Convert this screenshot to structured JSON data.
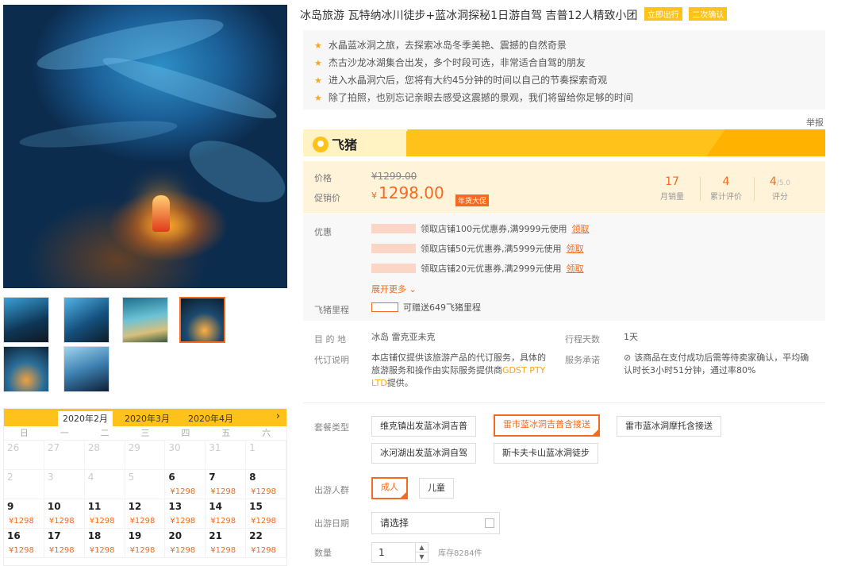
{
  "product": {
    "title": "冰岛旅游 瓦特纳冰川徒步+蓝冰洞探秘1日游自驾 吉普12人精致小团",
    "tags": [
      "立即出行",
      "二次确认"
    ],
    "highlights": [
      "水晶蓝冰洞之旅，去探索冰岛冬季美艳、震撼的自然奇景",
      "杰古沙龙冰湖集合出发，多个时段可选，非常适合自驾的朋友",
      "进入水晶洞穴后，您将有大约45分钟的时间以自己的节奏探索奇观",
      "除了拍照，也别忘记亲眼去感受这震撼的景观，我们将留给你足够的时间"
    ],
    "report_label": "举报"
  },
  "brand": {
    "name": "飞猪",
    "accent": "#ffc21a",
    "orange": "#f56a1f"
  },
  "price": {
    "label": "价格",
    "original": "¥1299.00",
    "promo_label": "促销价",
    "currency": "¥",
    "current": "1298.00",
    "badge": "年货大促",
    "stats": [
      {
        "value": "17",
        "label": "月销量"
      },
      {
        "value": "4",
        "label": "累计评价"
      },
      {
        "value": "4",
        "suffix": "/5.0",
        "label": "评分"
      }
    ]
  },
  "promotions": {
    "label": "优惠",
    "coupons": [
      {
        "text": "领取店铺100元优惠券,满9999元使用",
        "action": "领取"
      },
      {
        "text": "领取店铺50元优惠券,满5999元使用",
        "action": "领取"
      },
      {
        "text": "领取店铺20元优惠券,满2999元使用",
        "action": "领取"
      }
    ],
    "more": "展开更多",
    "miles_label": "飞猪里程",
    "miles_text": "可赠送649飞猪里程"
  },
  "details": {
    "dest_label": "目 的 地",
    "dest_value": "冰岛  雷克亚未克",
    "days_label": "行程天数",
    "days_value": "1天",
    "agency_label": "代订说明",
    "agency_text": "本店铺仅提供该旅游产品的代订服务，具体的旅游服务和操作由实际服务提供商",
    "agency_company": "GDST PTY LTD",
    "agency_end": "提供。",
    "promise_label": "服务承诺",
    "promise_text": "该商品在支付成功后需等待卖家确认，平均确认时长3小时51分钟，通过率80%"
  },
  "package": {
    "label": "套餐类型",
    "options": [
      "维克镇出发蓝冰洞吉普",
      "雷市蓝冰洞吉普含接送",
      "雷市蓝冰洞摩托含接送",
      "冰河湖出发蓝冰洞自驾",
      "斯卡夫卡山蓝冰洞徒步"
    ],
    "selected": "雷市蓝冰洞吉普含接送"
  },
  "travelers": {
    "label": "出游人群",
    "options": [
      "成人",
      "儿童"
    ],
    "selected": "成人"
  },
  "travel_date": {
    "label": "出游日期",
    "placeholder": "请选择"
  },
  "quantity": {
    "label": "数量",
    "value": "1",
    "stock": "库存8284件"
  },
  "calendar": {
    "months": [
      "2020年2月",
      "2020年3月",
      "2020年4月"
    ],
    "active_month": "2020年2月",
    "next_icon": "chevron-right-icon",
    "weekdays": [
      "日",
      "一",
      "二",
      "三",
      "四",
      "五",
      "六"
    ],
    "cells": [
      {
        "d": "26",
        "dim": true
      },
      {
        "d": "27",
        "dim": true
      },
      {
        "d": "28",
        "dim": true
      },
      {
        "d": "29",
        "dim": true
      },
      {
        "d": "30",
        "dim": true
      },
      {
        "d": "31",
        "dim": true
      },
      {
        "d": "1",
        "dim": true
      },
      {
        "d": "2",
        "dim": true
      },
      {
        "d": "3",
        "dim": true
      },
      {
        "d": "4",
        "dim": true
      },
      {
        "d": "5",
        "dim": true
      },
      {
        "d": "6",
        "p": "¥1298"
      },
      {
        "d": "7",
        "p": "¥1298"
      },
      {
        "d": "8",
        "p": "¥1298"
      },
      {
        "d": "9",
        "p": "¥1298"
      },
      {
        "d": "10",
        "p": "¥1298"
      },
      {
        "d": "11",
        "p": "¥1298"
      },
      {
        "d": "12",
        "p": "¥1298"
      },
      {
        "d": "13",
        "p": "¥1298"
      },
      {
        "d": "14",
        "p": "¥1298"
      },
      {
        "d": "15",
        "p": "¥1298"
      },
      {
        "d": "16",
        "p": "¥1298"
      },
      {
        "d": "17",
        "p": "¥1298"
      },
      {
        "d": "18",
        "p": "¥1298"
      },
      {
        "d": "19",
        "p": "¥1298"
      },
      {
        "d": "20",
        "p": "¥1298"
      },
      {
        "d": "21",
        "p": "¥1298"
      },
      {
        "d": "22",
        "p": "¥1298"
      }
    ]
  }
}
